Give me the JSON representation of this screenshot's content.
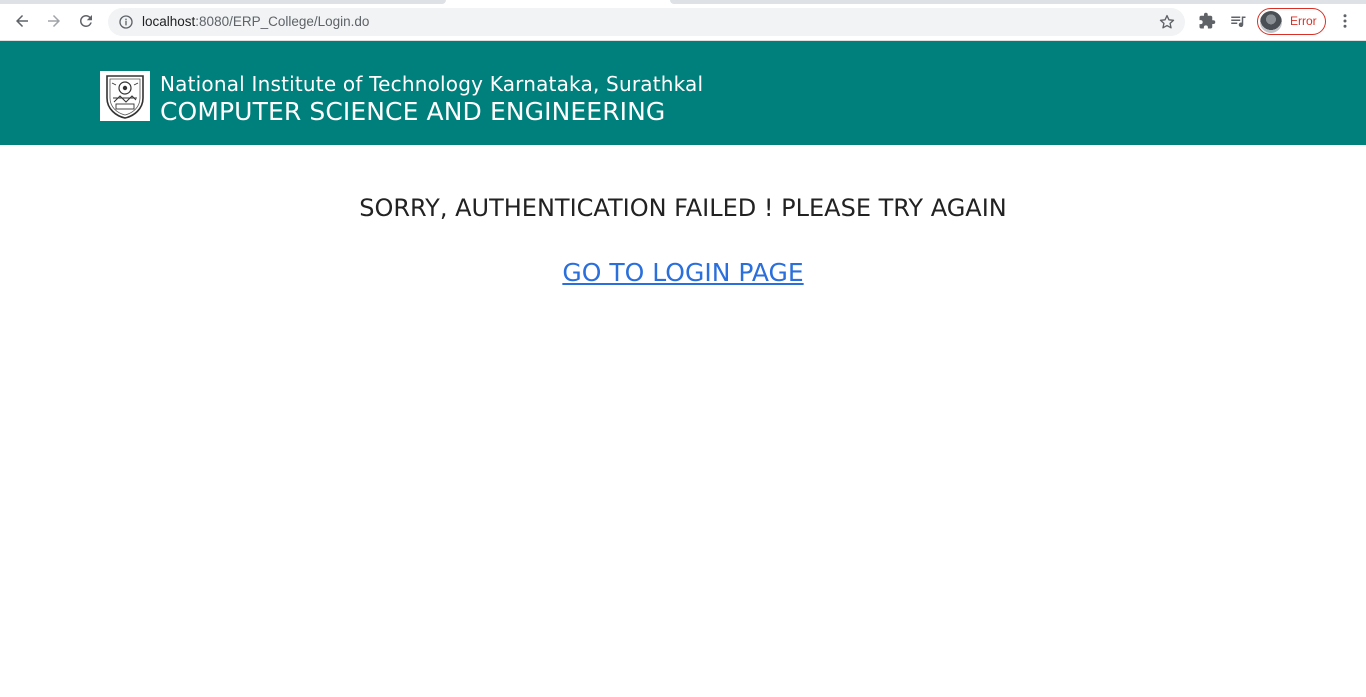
{
  "browser": {
    "url_host": "localhost",
    "url_rest": ":8080/ERP_College/Login.do",
    "profile_status": "Error"
  },
  "header": {
    "institute_name": "National Institute of Technology Karnataka, Surathkal",
    "department_name": "COMPUTER SCIENCE AND ENGINEERING",
    "background_color": "#00807d"
  },
  "main": {
    "error_message": "SORRY, AUTHENTICATION FAILED ! PLEASE TRY AGAIN",
    "login_link_text": "GO TO LOGIN PAGE",
    "link_color": "#2a6fdb"
  }
}
